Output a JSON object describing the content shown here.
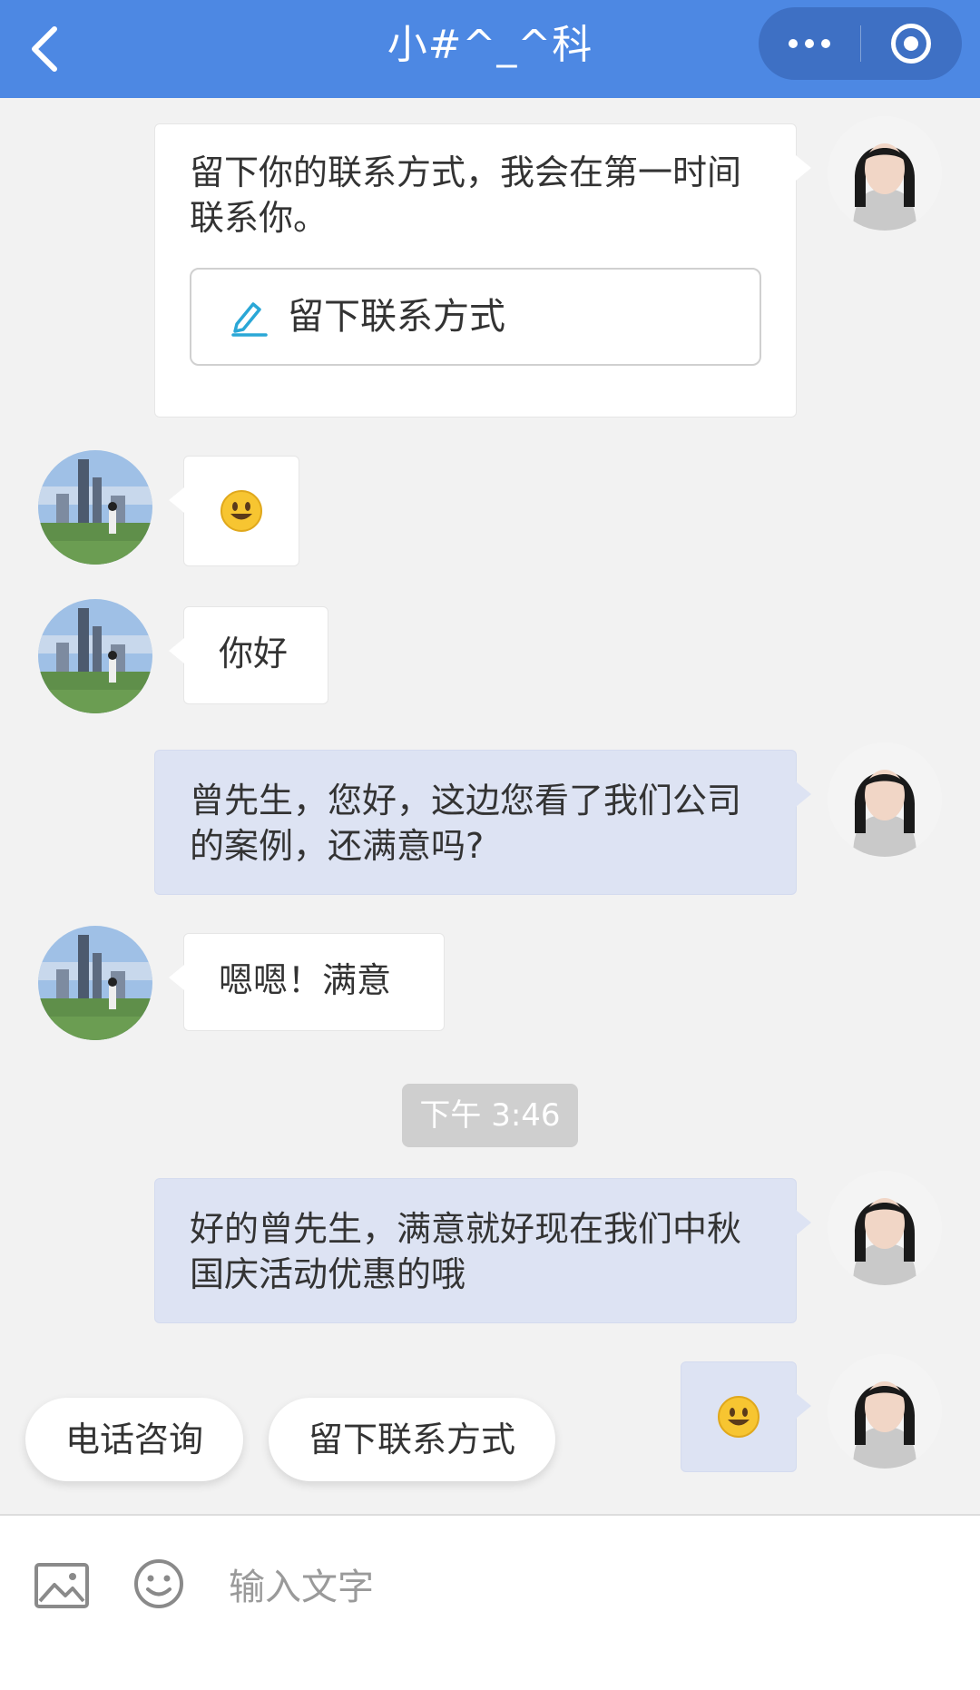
{
  "header": {
    "title": "小#^_^科",
    "back_icon": "chevron-left-icon",
    "menu_icon": "more-dots-icon",
    "close_icon": "target-circle-icon",
    "color": "#4d88e3"
  },
  "messages": [
    {
      "side": "agent",
      "text": "留下你的联系方式，我会在第一时间联系你。",
      "button_label": "留下联系方式",
      "button_icon": "edit-pencil-icon"
    },
    {
      "side": "customer",
      "emoji": "😃"
    },
    {
      "side": "customer",
      "text": "你好"
    },
    {
      "side": "agent",
      "text": "曾先生，您好，这边您看了我们公司的案例，还满意吗?"
    },
    {
      "side": "customer",
      "text": "嗯嗯！满意"
    },
    {
      "side": "timestamp",
      "text": "下午 3:46"
    },
    {
      "side": "agent",
      "text": "好的曾先生，满意就好现在我们中秋国庆活动优惠的哦"
    },
    {
      "side": "agent",
      "emoji": "😃"
    }
  ],
  "quick_replies": [
    "电话咨询",
    "留下联系方式"
  ],
  "input": {
    "placeholder": "输入文字",
    "image_icon": "image-icon",
    "emoji_icon": "smiley-icon"
  },
  "colors": {
    "agent_bubble": "#dde3f3",
    "customer_bubble": "#ffffff",
    "background": "#f2f2f2"
  }
}
